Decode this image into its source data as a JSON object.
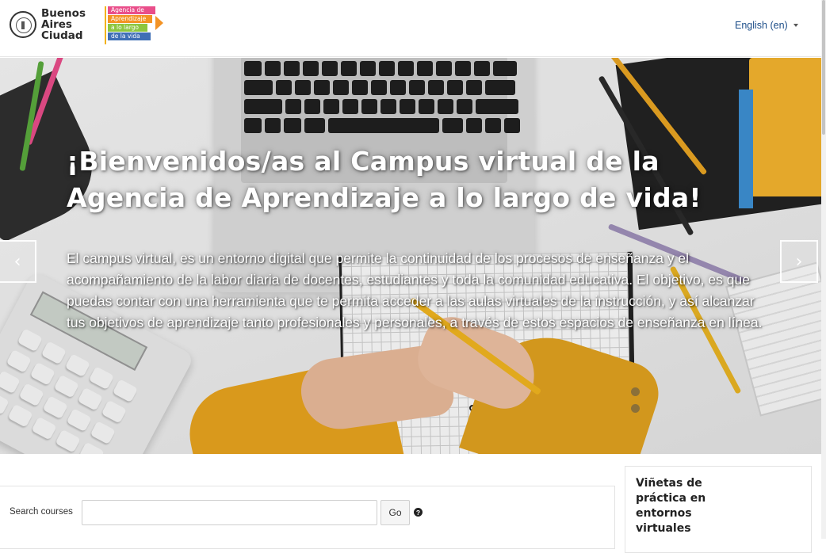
{
  "header": {
    "logo_primary_text": [
      "Buenos",
      "Aires",
      "Ciudad"
    ],
    "logo_secondary_text": [
      "Agencia de",
      "Aprendizaje",
      "a lo largo",
      "de la vida"
    ],
    "language_label": "English (en)"
  },
  "hero": {
    "title": "¡Bienvenidos/as al Campus virtual de la Agencia de Aprendizaje a lo largo de vida!",
    "body": "El campus virtual, es un entorno digital que permite la continuidad de los procesos de enseñanza y el acompañamiento de la labor diaria de docentes, estudiantes y toda la comunidad educativa. El objetivo, es que puedas contar con una herramienta que te permita acceder a las aulas virtuales de la instrucción, y así alcanzar tus objetivos de aprendizaje tanto profesionales y personales, a través de estos espacios de enseñanza en línea.",
    "prev_icon": "chevron-left-icon",
    "next_icon": "chevron-right-icon",
    "prev_glyph": "‹",
    "next_glyph": "›",
    "indicator_count": 2
  },
  "search": {
    "label": "Search courses",
    "input_value": "",
    "button_label": "Go",
    "help_icon": "question-circle-icon",
    "help_glyph": "?"
  },
  "sidebar": {
    "block_title": "Viñetas de práctica en entornos virtuales"
  },
  "colors": {
    "accent_link": "#1d4e89",
    "logo_yellow": "#f2b21c",
    "agencia_pink": "#e94e8a",
    "agencia_orange": "#f39325",
    "agencia_green": "#8dc63f",
    "agencia_blue": "#3f6fb5"
  }
}
